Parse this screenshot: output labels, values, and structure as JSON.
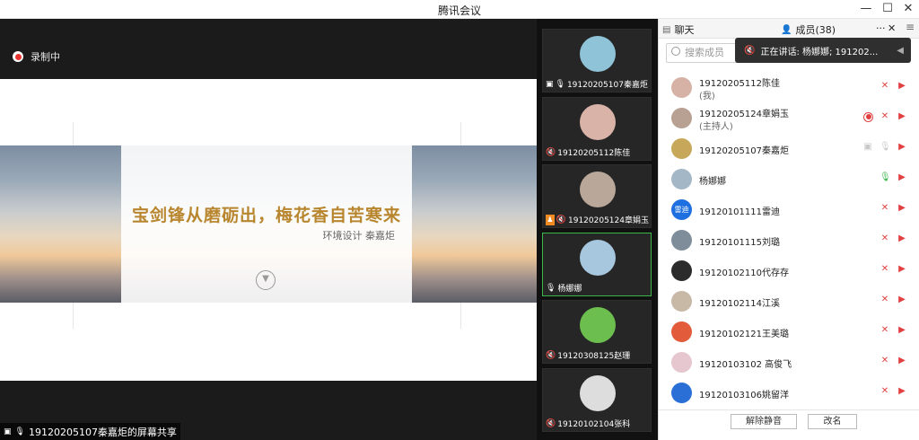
{
  "window": {
    "title": "腾讯会议",
    "minimize": "—",
    "maximize": "☐",
    "close": "✕"
  },
  "share": {
    "recording_label": "录制中",
    "slide_headline": "宝剑锋从磨砺出，梅花香自苦寒来",
    "slide_subtitle": "环境设计 秦嘉炬",
    "share_caption": "19120205107秦嘉炬的屏幕共享"
  },
  "videos": [
    {
      "name": "19120205107秦嘉炬...",
      "avatar_color": "#8fc3d8"
    },
    {
      "name": "19120205112陈佳",
      "avatar_color": "#d9b3a8"
    },
    {
      "name": "19120205124章娟玉",
      "avatar_color": "#b9a89a"
    },
    {
      "name": "杨娜娜",
      "avatar_color": "#a6c7de"
    },
    {
      "name": "19120308125赵珊",
      "avatar_color": "#6cbf4f"
    },
    {
      "name": "19120102104张科",
      "avatar_color": "#dddddd"
    }
  ],
  "panel": {
    "tab_chat": "聊天",
    "tab_members": "成员(38)",
    "more": "···",
    "close": "✕",
    "menu": "≡",
    "search_placeholder": "搜索成员",
    "speaking": "正在讲话: 杨娜娜; 191202..."
  },
  "members": [
    {
      "name": "19120205112陈佳",
      "role": "(我)",
      "avatar_color": "#d6b1a6"
    },
    {
      "name": "19120205124章娟玉",
      "role": "(主持人)",
      "avatar_color": "#b8a092"
    },
    {
      "name": "19120205107秦嘉炬",
      "role": "",
      "avatar_color": "#c7a85a"
    },
    {
      "name": "杨娜娜",
      "role": "",
      "avatar_color": "#a4b7c7"
    },
    {
      "name": "19120101111雷迪",
      "role": "",
      "avatar_color": "#1e6fe0",
      "avatar_text": "雷迪"
    },
    {
      "name": "19120101115刘璐",
      "role": "",
      "avatar_color": "#7f8c9a"
    },
    {
      "name": "19120102110代存存",
      "role": "",
      "avatar_color": "#2b2b2b"
    },
    {
      "name": "19120102114江溪",
      "role": "",
      "avatar_color": "#c8b8a6"
    },
    {
      "name": "19120102121王美璐",
      "role": "",
      "avatar_color": "#e25b3a"
    },
    {
      "name": "19120103102 高俊飞",
      "role": "",
      "avatar_color": "#e6c7cf"
    },
    {
      "name": "19120103106姚留洋",
      "role": "",
      "avatar_color": "#2a6fd6"
    }
  ],
  "buttons": {
    "unmute": "解除静音",
    "rename": "改名"
  }
}
